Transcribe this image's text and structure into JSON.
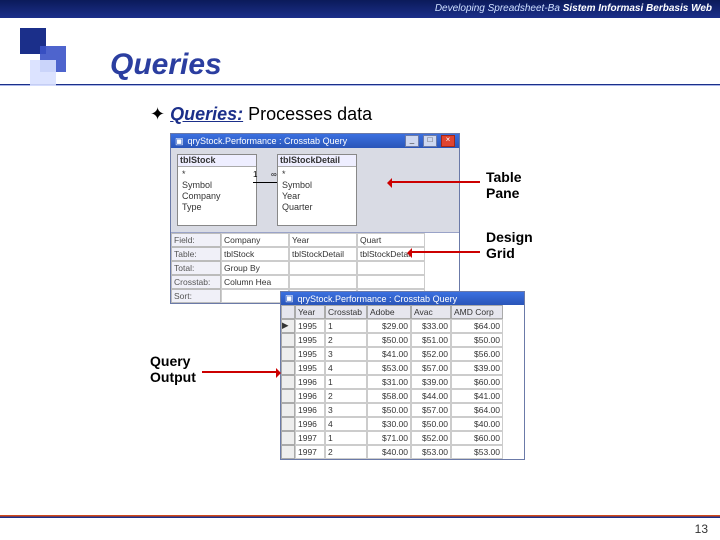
{
  "header": {
    "left_text": "Developing Spreadsheet-Ba",
    "right_text": "Sistem Informasi Berbasis Web"
  },
  "title": "Queries",
  "subtitle": {
    "lead": "Queries:",
    "rest": " Processes data"
  },
  "labels": {
    "table_pane": "Table\nPane",
    "design_grid": "Design\nGrid",
    "query_output": "Query\nOutput"
  },
  "design_window": {
    "title": "qryStock.Performance : Crosstab Query",
    "tables": {
      "left": {
        "name": "tblStock",
        "fields": [
          "*",
          "Symbol",
          "Company",
          "Type"
        ]
      },
      "right": {
        "name": "tblStockDetail",
        "fields": [
          "*",
          "Symbol",
          "Year",
          "Quarter"
        ]
      },
      "link": {
        "left_card": "1",
        "right_card": "∞"
      }
    },
    "grid_rows": [
      "Field:",
      "Table:",
      "Total:",
      "Crosstab:",
      "Sort:"
    ],
    "grid_cols": [
      {
        "Field": "Company",
        "Table": "tblStock",
        "Total": "Group By",
        "Crosstab": "Column Hea",
        "Sort": ""
      },
      {
        "Field": "Year",
        "Table": "tblStockDetail",
        "Total": "",
        "Crosstab": "",
        "Sort": ""
      },
      {
        "Field": "Quart",
        "Table": "tblStockDetail",
        "Total": "",
        "Crosstab": "",
        "Sort": ""
      }
    ]
  },
  "output_window": {
    "title": "qryStock.Performance : Crosstab Query",
    "columns": [
      "",
      "Year",
      "Crosstab",
      "Adobe",
      "Avac",
      "AMD Corp"
    ],
    "rows": [
      [
        "▶",
        "1995",
        "1",
        "$29.00",
        "$33.00",
        "$64.00"
      ],
      [
        "",
        "1995",
        "2",
        "$50.00",
        "$51.00",
        "$50.00"
      ],
      [
        "",
        "1995",
        "3",
        "$41.00",
        "$52.00",
        "$56.00"
      ],
      [
        "",
        "1995",
        "4",
        "$53.00",
        "$57.00",
        "$39.00"
      ],
      [
        "",
        "1996",
        "1",
        "$31.00",
        "$39.00",
        "$60.00"
      ],
      [
        "",
        "1996",
        "2",
        "$58.00",
        "$44.00",
        "$41.00"
      ],
      [
        "",
        "1996",
        "3",
        "$50.00",
        "$57.00",
        "$64.00"
      ],
      [
        "",
        "1996",
        "4",
        "$30.00",
        "$50.00",
        "$40.00"
      ],
      [
        "",
        "1997",
        "1",
        "$71.00",
        "$52.00",
        "$60.00"
      ],
      [
        "",
        "1997",
        "2",
        "$40.00",
        "$53.00",
        "$53.00"
      ]
    ]
  },
  "page_number": "13"
}
